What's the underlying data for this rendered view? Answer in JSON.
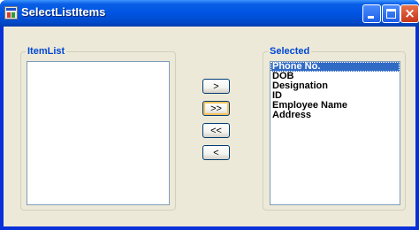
{
  "window": {
    "title": "SelectListItems",
    "controls": {
      "minimize": "minimize",
      "maximize": "maximize",
      "close": "×"
    }
  },
  "groups": {
    "item_list": {
      "label": "ItemList",
      "items": []
    },
    "selected": {
      "label": "Selected",
      "items": [
        "Phone No.",
        "DOB",
        "Designation",
        "ID",
        "Employee Name",
        "Address"
      ],
      "selected_item": "Phone No."
    }
  },
  "buttons": {
    "move_one_right": ">",
    "move_all_right": ">>",
    "move_all_left": "<<",
    "move_one_left": "<"
  },
  "colors": {
    "titlebar": "#0054e3",
    "client_background": "#ece9d8",
    "group_label": "#0046d5",
    "selection": "#316ac5"
  },
  "icons": {
    "app": "form-window-icon",
    "minimize": "minimize-icon",
    "maximize": "maximize-icon",
    "close": "close-icon"
  }
}
